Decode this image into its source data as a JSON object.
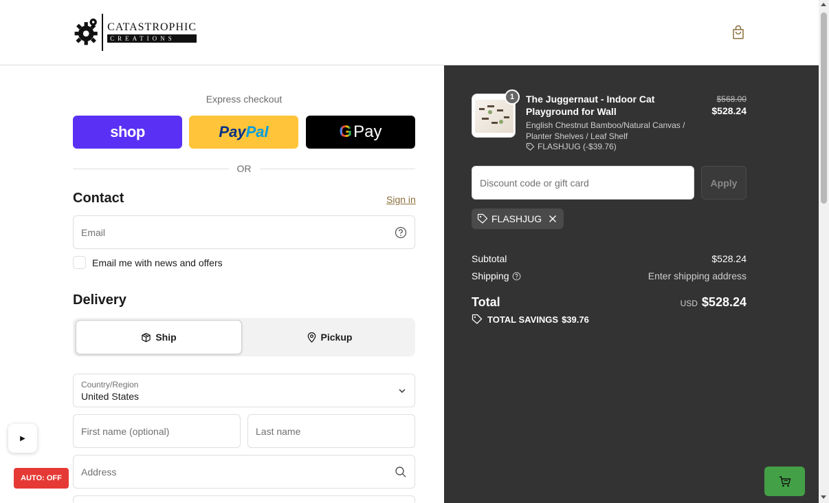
{
  "header": {
    "brand_top": "CATASTROPHIC",
    "brand_bottom": "CREATIONS",
    "cart_icon": "shopping-bag-icon"
  },
  "express": {
    "label": "Express checkout",
    "shop_label": "shop",
    "paypal_label_1": "Pay",
    "paypal_label_2": "Pal",
    "gpay_g": "G",
    "gpay_label": "Pay",
    "or_label": "OR"
  },
  "contact": {
    "title": "Contact",
    "signin_label": "Sign in",
    "email_placeholder": "Email",
    "newsletter_label": "Email me with news and offers"
  },
  "delivery": {
    "title": "Delivery",
    "ship_label": "Ship",
    "pickup_label": "Pickup",
    "country_label": "Country/Region",
    "country_value": "United States",
    "first_name_placeholder": "First name (optional)",
    "last_name_placeholder": "Last name",
    "address_placeholder": "Address"
  },
  "summary": {
    "quantity": "1",
    "item_title": "The Juggernaut - Indoor Cat Playground for Wall",
    "item_variant": "English Chestnut Bamboo/Natural Canvas / Planter Shelves / Leaf Shelf",
    "item_discount": "FLASHJUG (-$39.76)",
    "price_old": "$568.00",
    "price_new": "$528.24",
    "discount_placeholder": "Discount code or gift card",
    "apply_label": "Apply",
    "applied_code": "FLASHJUG",
    "subtotal_label": "Subtotal",
    "subtotal_value": "$528.24",
    "shipping_label": "Shipping",
    "shipping_value": "Enter shipping address",
    "total_label": "Total",
    "currency": "USD",
    "total_value": "$528.24",
    "savings_label": "TOTAL SAVINGS",
    "savings_value": "$39.76"
  },
  "overlay": {
    "play_glyph": "▶",
    "auto_label": "AUTO: OFF"
  },
  "colors": {
    "shop_purple": "#5a31f4",
    "paypal_yellow": "#ffc439",
    "summary_bg": "#333333",
    "link_gold": "#8b6e3a",
    "auto_red": "#e53935",
    "cart_green": "#43a047"
  }
}
